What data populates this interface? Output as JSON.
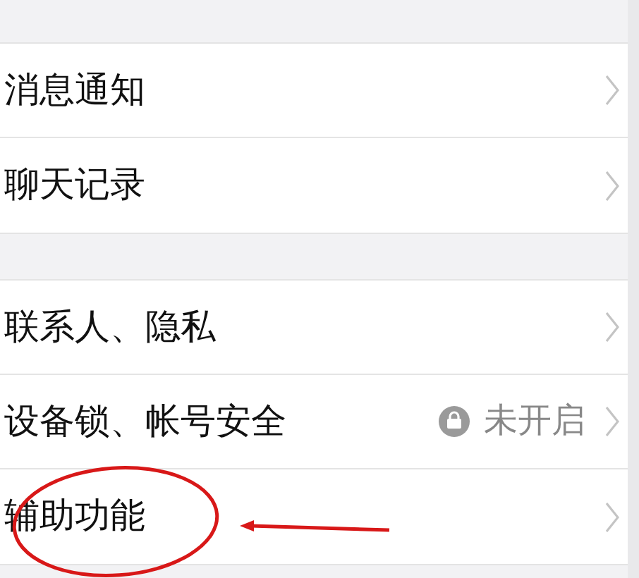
{
  "sections": [
    {
      "items": [
        {
          "label": "消息通知"
        },
        {
          "label": "聊天记录"
        }
      ]
    },
    {
      "items": [
        {
          "label": "联系人、隐私"
        },
        {
          "label": "设备锁、帐号安全",
          "value": "未开启",
          "locked": true
        },
        {
          "label": "辅助功能"
        }
      ]
    }
  ]
}
